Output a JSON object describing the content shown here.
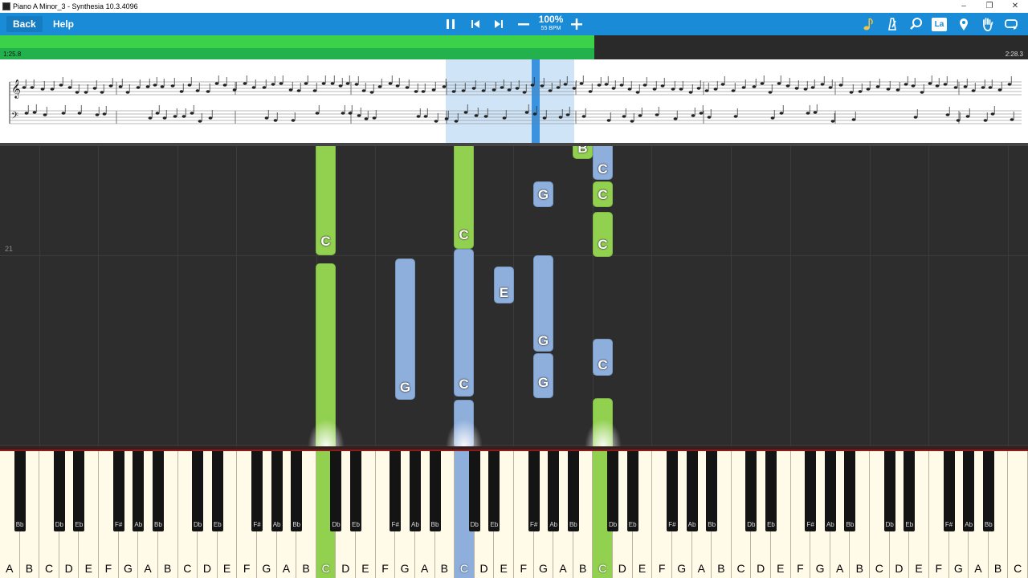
{
  "window": {
    "title": "Piano A Minor_3 - Synthesia 10.3.4096"
  },
  "toolbar": {
    "back_label": "Back",
    "help_label": "Help",
    "speed_percent": "100%",
    "speed_bpm": "55 BPM",
    "lang_label": "La",
    "icons": [
      "pause-icon",
      "skip-back-icon",
      "skip-forward-icon",
      "minus-icon",
      "plus-icon",
      "metronome-note-icon",
      "metronome-icon",
      "magnifier-icon",
      "lang-icon",
      "location-pin-icon",
      "hand-icon",
      "loop-icon"
    ]
  },
  "progress": {
    "current_time": "1:25.8",
    "total_time": "2:28.3",
    "fraction": 0.578
  },
  "notes_area": {
    "measure_number": "21"
  },
  "colors": {
    "right_hand": "#92d050",
    "left_hand": "#8eaedb",
    "toolbar": "#1a8bd6",
    "progress": "#22b14c"
  },
  "falling_notes": [
    {
      "label": "C",
      "hand": "right"
    },
    {
      "label": "",
      "hand": "right"
    },
    {
      "label": "G",
      "hand": "left"
    },
    {
      "label": "C",
      "hand": "right"
    },
    {
      "label": "C",
      "hand": "left"
    },
    {
      "label": "",
      "hand": "left"
    },
    {
      "label": "E",
      "hand": "left"
    },
    {
      "label": "G",
      "hand": "left"
    },
    {
      "label": "G",
      "hand": "left"
    },
    {
      "label": "G",
      "hand": "left"
    },
    {
      "label": "B",
      "hand": "right"
    },
    {
      "label": "C",
      "hand": "left"
    },
    {
      "label": "C",
      "hand": "right"
    },
    {
      "label": "C",
      "hand": "right"
    },
    {
      "label": "C",
      "hand": "left"
    },
    {
      "label": "",
      "hand": "right"
    }
  ],
  "keyboard": {
    "white_keys": [
      "A",
      "B",
      "C",
      "D",
      "E",
      "F",
      "G",
      "A",
      "B",
      "C",
      "D",
      "E",
      "F",
      "G",
      "A",
      "B",
      "C",
      "D",
      "E",
      "F",
      "G",
      "A",
      "B",
      "C",
      "D",
      "E",
      "F",
      "G",
      "A",
      "B",
      "C",
      "D",
      "E",
      "F",
      "G",
      "A",
      "B",
      "C",
      "D",
      "E",
      "F",
      "G",
      "A",
      "B",
      "C",
      "D",
      "E",
      "F",
      "G",
      "A",
      "B",
      "C"
    ],
    "black_keys": [
      "Bb",
      "Db",
      "Eb",
      "F#",
      "Ab",
      "Bb",
      "Db",
      "Eb",
      "F#",
      "Ab",
      "Bb",
      "Db",
      "Eb",
      "F#",
      "Ab",
      "Bb",
      "Db",
      "Eb",
      "F#",
      "Ab",
      "Bb",
      "Db",
      "Eb",
      "F#",
      "Ab",
      "Bb",
      "Db",
      "Eb",
      "F#",
      "Ab",
      "Bb",
      "Db",
      "Eb",
      "F#",
      "Ab",
      "Bb"
    ]
  }
}
